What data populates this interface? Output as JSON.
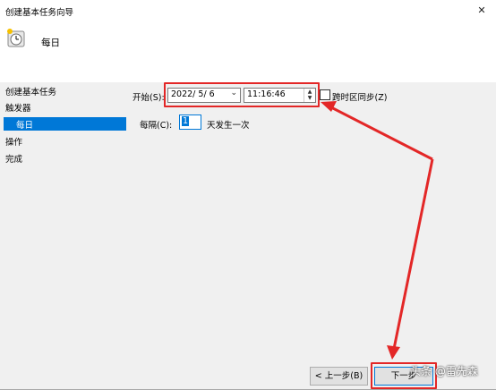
{
  "window": {
    "title": "创建基本任务向导",
    "close_glyph": "✕"
  },
  "header": {
    "title": "每日"
  },
  "sidebar": {
    "items": [
      {
        "label": "创建基本任务"
      },
      {
        "label": "触发器"
      },
      {
        "label": "每日"
      },
      {
        "label": "操作"
      },
      {
        "label": "完成"
      }
    ]
  },
  "form": {
    "start_label": "开始(S):",
    "date_value": "2022/ 5/ 6",
    "time_value": "11:16:46",
    "sync_label": "跨时区同步(Z)",
    "sync_checked": false,
    "recur_label": "每隔(C):",
    "recur_value": "1",
    "recur_suffix": "天发生一次"
  },
  "buttons": {
    "back_label": "< 上一步(B)",
    "next_label": "下一步"
  },
  "watermark": "头条 @雷先森",
  "colors": {
    "selection": "#0078d7",
    "annotation": "#e32727",
    "panel": "#f0f0f0"
  }
}
